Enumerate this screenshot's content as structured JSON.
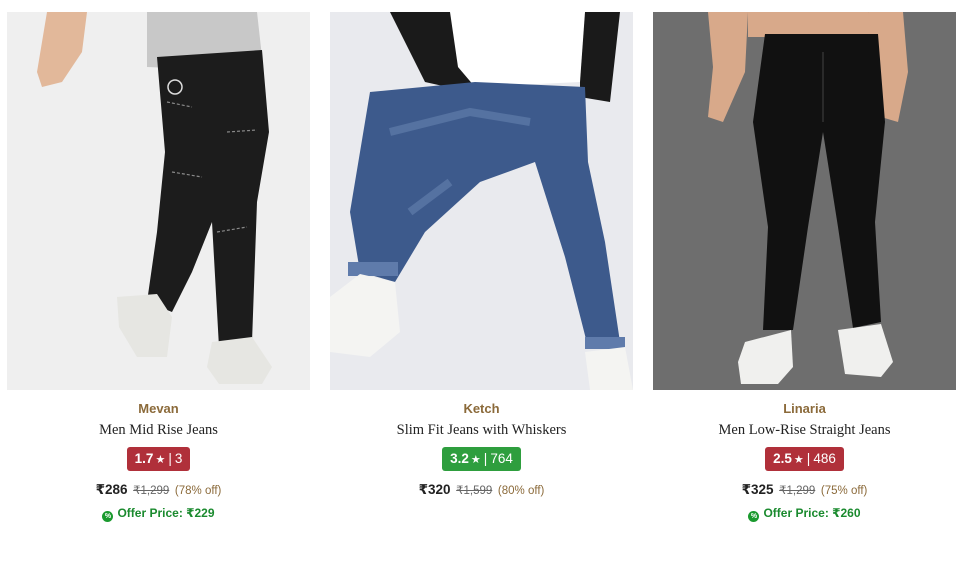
{
  "colors": {
    "brand_text": "#8b6a3a",
    "rating_low": "#b0303a",
    "rating_mid": "#2e9e3e",
    "offer_green": "#1a8a2e"
  },
  "products": [
    {
      "brand": "Mevan",
      "title": "Men Mid Rise Jeans",
      "rating": "1.7",
      "rating_count": "3",
      "rating_color": "#b0303a",
      "price": "₹286",
      "mrp": "₹1,299",
      "discount": "(78% off)",
      "offer_label": "Offer Price: ₹229",
      "icon": "percent-badge-icon"
    },
    {
      "brand": "Ketch",
      "title": "Slim Fit Jeans with Whiskers",
      "rating": "3.2",
      "rating_count": "764",
      "rating_color": "#2e9e3e",
      "price": "₹320",
      "mrp": "₹1,599",
      "discount": "(80% off)"
    },
    {
      "brand": "Linaria",
      "title": "Men Low-Rise Straight Jeans",
      "rating": "2.5",
      "rating_count": "486",
      "rating_color": "#b0303a",
      "price": "₹325",
      "mrp": "₹1,299",
      "discount": "(75% off)",
      "offer_label": "Offer Price: ₹260",
      "icon": "percent-badge-icon"
    }
  ],
  "star_glyph": "★",
  "separator": "|"
}
